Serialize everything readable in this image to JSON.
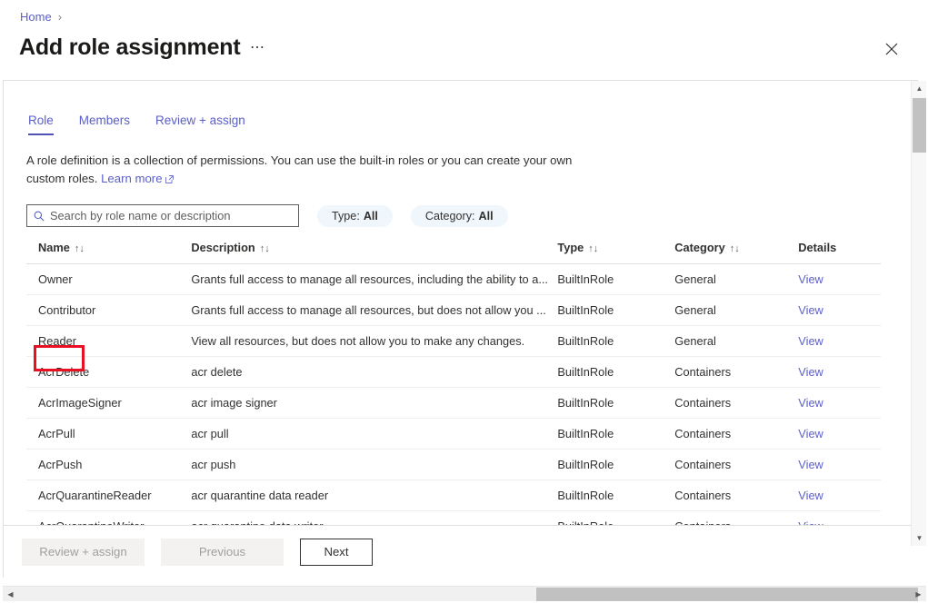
{
  "breadcrumb": {
    "home_label": "Home",
    "separator": "›"
  },
  "header": {
    "title": "Add role assignment",
    "more_label": "⋯",
    "close_icon": "close-icon"
  },
  "tabs": [
    {
      "label": "Role",
      "active": true
    },
    {
      "label": "Members",
      "active": false
    },
    {
      "label": "Review + assign",
      "active": false
    }
  ],
  "description": {
    "text": "A role definition is a collection of permissions. You can use the built-in roles or you can create your own custom roles.",
    "link_label": "Learn more"
  },
  "search": {
    "placeholder": "Search by role name or description",
    "value": ""
  },
  "filters": [
    {
      "name": "Type",
      "separator": " : ",
      "value": "All"
    },
    {
      "name": "Category",
      "separator": " : ",
      "value": "All"
    }
  ],
  "table": {
    "columns": [
      {
        "label": "Name",
        "sortable": true,
        "sort_glyph": "↑↓"
      },
      {
        "label": "Description",
        "sortable": true,
        "sort_glyph": "↑↓"
      },
      {
        "label": "Type",
        "sortable": true,
        "sort_glyph": "↑↓"
      },
      {
        "label": "Category",
        "sortable": true,
        "sort_glyph": "↑↓"
      },
      {
        "label": "Details",
        "sortable": false,
        "sort_glyph": ""
      }
    ],
    "rows": [
      {
        "name": "Owner",
        "description": "Grants full access to manage all resources, including the ability to a...",
        "type": "BuiltInRole",
        "category": "General",
        "details": "View",
        "highlighted": true
      },
      {
        "name": "Contributor",
        "description": "Grants full access to manage all resources, but does not allow you ...",
        "type": "BuiltInRole",
        "category": "General",
        "details": "View",
        "highlighted": false
      },
      {
        "name": "Reader",
        "description": "View all resources, but does not allow you to make any changes.",
        "type": "BuiltInRole",
        "category": "General",
        "details": "View",
        "highlighted": false
      },
      {
        "name": "AcrDelete",
        "description": "acr delete",
        "type": "BuiltInRole",
        "category": "Containers",
        "details": "View",
        "highlighted": false
      },
      {
        "name": "AcrImageSigner",
        "description": "acr image signer",
        "type": "BuiltInRole",
        "category": "Containers",
        "details": "View",
        "highlighted": false
      },
      {
        "name": "AcrPull",
        "description": "acr pull",
        "type": "BuiltInRole",
        "category": "Containers",
        "details": "View",
        "highlighted": false
      },
      {
        "name": "AcrPush",
        "description": "acr push",
        "type": "BuiltInRole",
        "category": "Containers",
        "details": "View",
        "highlighted": false
      },
      {
        "name": "AcrQuarantineReader",
        "description": "acr quarantine data reader",
        "type": "BuiltInRole",
        "category": "Containers",
        "details": "View",
        "highlighted": false
      },
      {
        "name": "AcrQuarantineWriter",
        "description": "acr quarantine data writer",
        "type": "BuiltInRole",
        "category": "Containers",
        "details": "View",
        "highlighted": false
      }
    ]
  },
  "actions": {
    "review_assign_label": "Review + assign",
    "previous_label": "Previous",
    "next_label": "Next"
  },
  "colors": {
    "link": "#5b5fc7",
    "tab_underline": "#4f52b2",
    "pill_bg": "#eff6fc",
    "annotation": "#e81123",
    "border": "#e1dfdd"
  }
}
